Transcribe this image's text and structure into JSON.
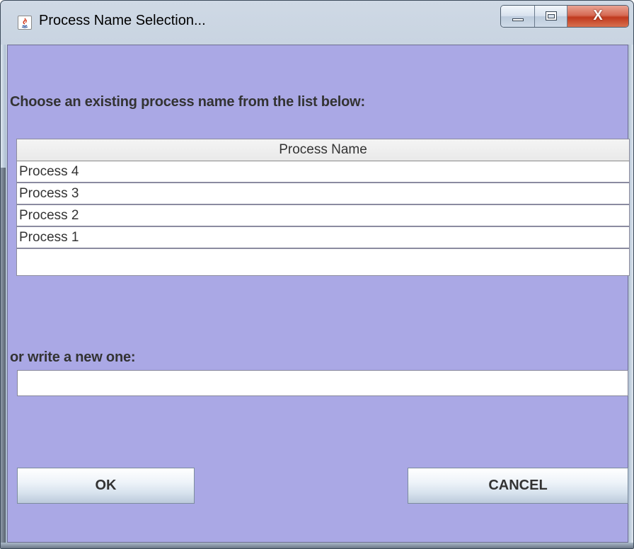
{
  "window": {
    "title": "Process Name Selection...",
    "app_icon": "java-icon",
    "controls": {
      "minimize_icon": "minimize-icon",
      "maximize_icon": "maximize-icon",
      "close_icon": "close-icon",
      "close_glyph": "X"
    }
  },
  "dialog": {
    "background_color": "#aaa8e5",
    "prompt": "Choose an existing process name from the list below:",
    "table": {
      "header": "Process Name",
      "rows": [
        "Process 4",
        "Process 3",
        "Process 2",
        "Process 1"
      ]
    },
    "new_label": "or write a new one:",
    "new_value": "",
    "ok_label": "OK",
    "cancel_label": "CANCEL"
  }
}
